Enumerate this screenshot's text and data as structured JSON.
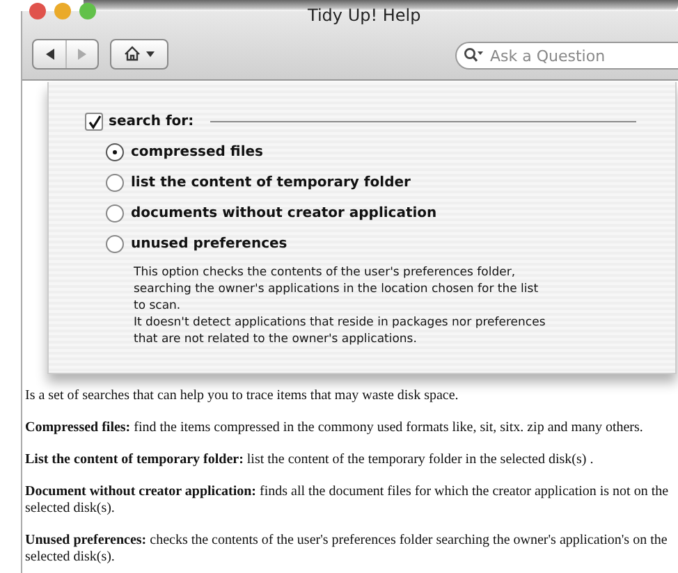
{
  "window": {
    "title": "Tidy Up! Help"
  },
  "toolbar": {
    "search": {
      "placeholder": "Ask a Question"
    }
  },
  "dialog": {
    "search_for": {
      "label": "search for:",
      "checked": true
    },
    "options": [
      {
        "label": "compressed files",
        "selected": true
      },
      {
        "label": "list the content of temporary folder",
        "selected": false
      },
      {
        "label": "documents without creator application",
        "selected": false
      },
      {
        "label": "unused preferences",
        "selected": false
      }
    ],
    "description": [
      "This option checks the contents of the user's preferences folder, searching the owner's applications in the location chosen for the list to scan.",
      "It doesn't detect applications that reside in packages nor preferences that are not related to the owner's applications."
    ]
  },
  "paragraphs": [
    "Is a set of searches that can help you to trace items that may waste disk space.",
    "**Compressed files:** find the items compressed in the commony used formats like, sit, sitx. zip and many others.",
    "**List the content of temporary folder:** list the content of the temporary folder in the selected disk(s) .",
    "**Document without creator application:** finds all the document files for which the creator application is not on the selected disk(s).",
    "**Unused preferences:** checks the contents of the user's preferences folder searching the owner's application's on the selected disk(s)."
  ]
}
